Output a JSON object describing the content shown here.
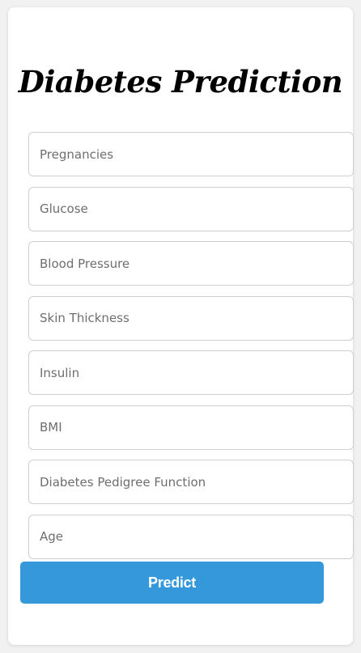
{
  "page": {
    "title": "Diabetes Prediction"
  },
  "form": {
    "fields": [
      {
        "placeholder": "Pregnancies",
        "value": ""
      },
      {
        "placeholder": "Glucose",
        "value": ""
      },
      {
        "placeholder": "Blood Pressure",
        "value": ""
      },
      {
        "placeholder": "Skin Thickness",
        "value": ""
      },
      {
        "placeholder": "Insulin",
        "value": ""
      },
      {
        "placeholder": "BMI",
        "value": ""
      },
      {
        "placeholder": "Diabetes Pedigree Function",
        "value": ""
      },
      {
        "placeholder": "Age",
        "value": ""
      }
    ],
    "submit_label": "Predict"
  },
  "colors": {
    "background": "#f1f1f1",
    "card": "#ffffff",
    "button": "#3498db",
    "button_text": "#ffffff",
    "input_border": "#cfcfcf",
    "title": "#000000"
  }
}
